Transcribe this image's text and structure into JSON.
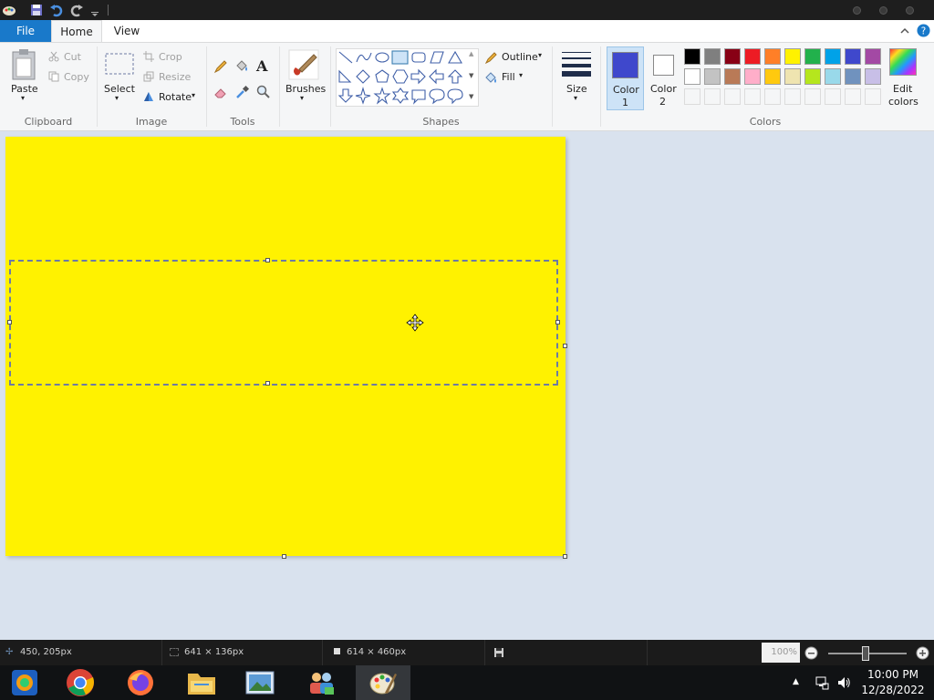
{
  "tabs": {
    "file": "File",
    "home": "Home",
    "view": "View"
  },
  "clipboard": {
    "paste": "Paste",
    "cut": "Cut",
    "copy": "Copy",
    "group": "Clipboard"
  },
  "image": {
    "select": "Select",
    "crop": "Crop",
    "resize": "Resize",
    "rotate": "Rotate",
    "group": "Image"
  },
  "tools": {
    "group": "Tools"
  },
  "brushes": {
    "label": "Brushes"
  },
  "shapes": {
    "outline": "Outline",
    "fill": "Fill",
    "group": "Shapes"
  },
  "size": {
    "label": "Size"
  },
  "colors": {
    "color1_line1": "Color",
    "color1_line2": "1",
    "color2_line1": "Color",
    "color2_line2": "2",
    "edit_line1": "Edit",
    "edit_line2": "colors",
    "group": "Colors",
    "color1_value": "#3f48cc",
    "color2_value": "#ffffff",
    "palette_row1": [
      "#000000",
      "#7f7f7f",
      "#880015",
      "#ed1c24",
      "#ff7f27",
      "#fff200",
      "#22b14c",
      "#00a2e8",
      "#3f48cc",
      "#a349a4"
    ],
    "palette_row2": [
      "#ffffff",
      "#c3c3c3",
      "#b97a57",
      "#ffaec9",
      "#ffc90e",
      "#efe4b0",
      "#b5e61d",
      "#99d9ea",
      "#7092be",
      "#c8bfe7"
    ]
  },
  "canvas": {
    "fill_color": "#fff200"
  },
  "status": {
    "cursor_pos": "450, 205px",
    "selection_size": "641 × 136px",
    "image_size": "614 × 460px",
    "zoom": "100%"
  },
  "taskbar": {
    "time": "10:00 PM",
    "date": "12/28/2022"
  }
}
